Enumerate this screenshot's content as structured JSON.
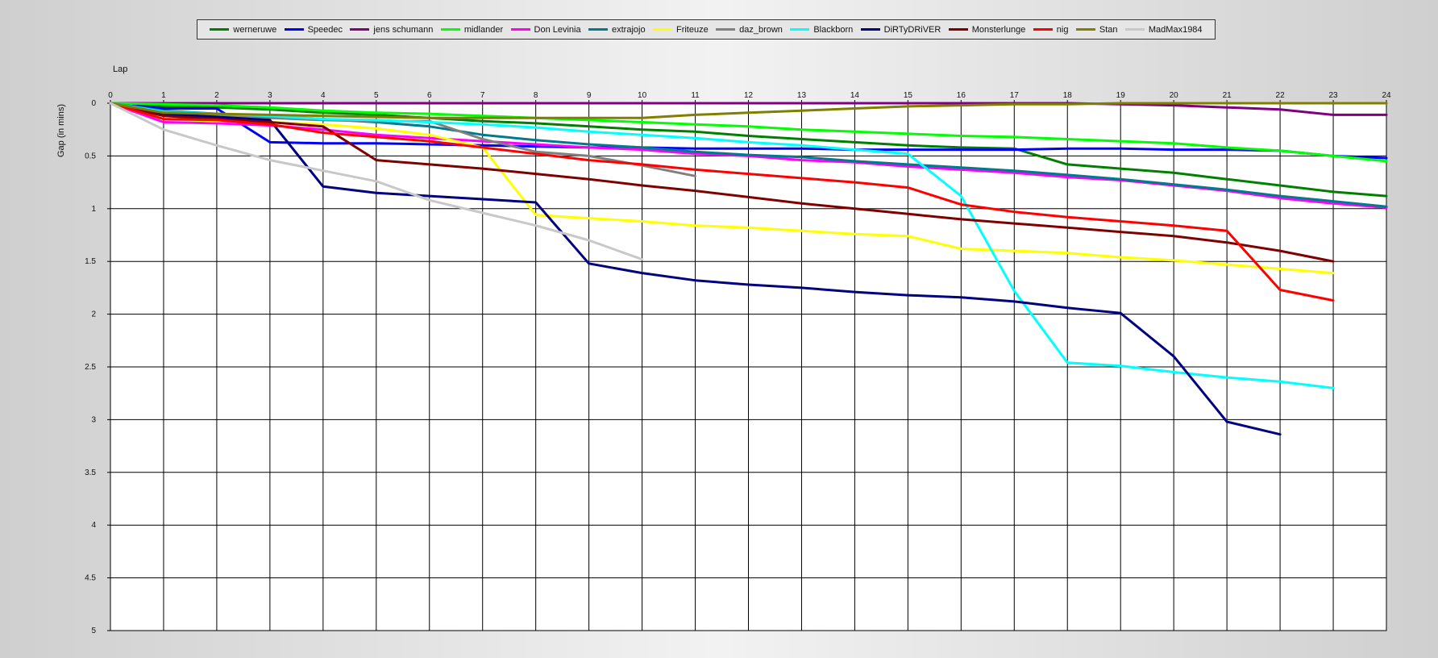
{
  "chart_data": {
    "type": "line",
    "title": "",
    "xlabel": "Lap",
    "ylabel": "Gap (in mins)",
    "xlim": [
      0,
      24
    ],
    "ylim": [
      0,
      5
    ],
    "y_inverted": true,
    "grid": true,
    "legend_position": "top",
    "x_ticks": [
      "0",
      "1",
      "2",
      "3",
      "4",
      "5",
      "6",
      "7",
      "8",
      "9",
      "10",
      "11",
      "12",
      "13",
      "14",
      "15",
      "16",
      "17",
      "18",
      "19",
      "20",
      "21",
      "22",
      "23",
      "24"
    ],
    "y_ticks": [
      "0",
      "0.5",
      "1",
      "1.5",
      "2",
      "2.5",
      "3",
      "3.5",
      "4",
      "4.5",
      "5"
    ],
    "series": [
      {
        "name": "werneruwe",
        "color": "#008000",
        "x": [
          0,
          1,
          2,
          3,
          4,
          5,
          6,
          7,
          8,
          9,
          10,
          11,
          12,
          13,
          14,
          15,
          16,
          17,
          18,
          19,
          20,
          21,
          22,
          23,
          24
        ],
        "values": [
          0,
          0.03,
          0.04,
          0.06,
          0.09,
          0.11,
          0.14,
          0.17,
          0.19,
          0.22,
          0.25,
          0.27,
          0.31,
          0.34,
          0.37,
          0.4,
          0.42,
          0.43,
          0.58,
          0.62,
          0.66,
          0.72,
          0.78,
          0.84,
          0.88
        ]
      },
      {
        "name": "Speedec",
        "color": "#0000FF",
        "x": [
          0,
          1,
          2,
          3,
          4,
          5,
          6,
          7,
          8,
          9,
          10,
          11,
          12,
          13,
          14,
          15,
          16,
          17,
          18,
          19,
          20,
          21,
          22,
          23,
          24
        ],
        "values": [
          0,
          0.05,
          0.05,
          0.37,
          0.38,
          0.38,
          0.39,
          0.4,
          0.41,
          0.42,
          0.42,
          0.43,
          0.43,
          0.43,
          0.44,
          0.44,
          0.44,
          0.44,
          0.43,
          0.43,
          0.44,
          0.44,
          0.45,
          0.5,
          0.52
        ]
      },
      {
        "name": "jens  schumann",
        "color": "#800080",
        "x": [
          0,
          1,
          2,
          3,
          4,
          5,
          6,
          7,
          8,
          9,
          10,
          11,
          12,
          13,
          14,
          15,
          16,
          17,
          18,
          19,
          20,
          21,
          22,
          23,
          24
        ],
        "values": [
          0,
          0,
          0,
          0,
          0,
          0,
          0,
          0,
          0,
          0,
          0,
          0,
          0,
          0,
          0,
          0,
          0,
          0,
          0,
          0.01,
          0.02,
          0.04,
          0.06,
          0.11,
          0.11
        ]
      },
      {
        "name": "midlander",
        "color": "#00FF00",
        "x": [
          0,
          1,
          2,
          3,
          4,
          5,
          6,
          7,
          8,
          9,
          10,
          11,
          12,
          13,
          14,
          15,
          16,
          17,
          18,
          19,
          20,
          21,
          22,
          23,
          24
        ],
        "values": [
          0,
          0.01,
          0.02,
          0.04,
          0.07,
          0.09,
          0.1,
          0.12,
          0.14,
          0.16,
          0.18,
          0.2,
          0.22,
          0.25,
          0.27,
          0.29,
          0.31,
          0.32,
          0.34,
          0.36,
          0.38,
          0.42,
          0.45,
          0.5,
          0.55
        ]
      },
      {
        "name": "Don Levinia",
        "color": "#FF00FF",
        "x": [
          0,
          1,
          2,
          3,
          4,
          5,
          6,
          7,
          8,
          9,
          10,
          11,
          12,
          13,
          14,
          15,
          16,
          17,
          18,
          19,
          20,
          21,
          22,
          23,
          24
        ],
        "values": [
          0,
          0.18,
          0.19,
          0.21,
          0.25,
          0.3,
          0.33,
          0.36,
          0.39,
          0.42,
          0.44,
          0.48,
          0.5,
          0.54,
          0.56,
          0.6,
          0.63,
          0.66,
          0.7,
          0.73,
          0.78,
          0.83,
          0.9,
          0.95,
          0.99
        ]
      },
      {
        "name": "extrajojo",
        "color": "#007A8C",
        "x": [
          0,
          1,
          2,
          3,
          4,
          5,
          6,
          7,
          8,
          9,
          10,
          11,
          12,
          13,
          14,
          15,
          16,
          17,
          18,
          19,
          20,
          21,
          22,
          23,
          24
        ],
        "values": [
          0,
          0.07,
          0.1,
          0.12,
          0.15,
          0.18,
          0.22,
          0.3,
          0.35,
          0.39,
          0.42,
          0.46,
          0.49,
          0.51,
          0.55,
          0.58,
          0.61,
          0.64,
          0.68,
          0.72,
          0.77,
          0.82,
          0.88,
          0.93,
          0.98
        ]
      },
      {
        "name": "Friteuze",
        "color": "#FFFF00",
        "x": [
          0,
          1,
          2,
          3,
          4,
          5,
          6,
          7,
          8,
          9,
          10,
          11,
          12,
          13,
          14,
          15,
          16,
          17,
          18,
          19,
          20,
          21,
          22,
          23
        ],
        "values": [
          0,
          0.15,
          0.17,
          0.18,
          0.2,
          0.24,
          0.3,
          0.42,
          1.06,
          1.09,
          1.12,
          1.16,
          1.18,
          1.21,
          1.24,
          1.26,
          1.38,
          1.4,
          1.42,
          1.46,
          1.49,
          1.53,
          1.57,
          1.61
        ]
      },
      {
        "name": "daz_brown",
        "color": "#808080",
        "x": [
          0,
          1,
          2,
          3,
          4,
          5,
          6,
          7,
          8,
          9,
          10,
          11
        ],
        "values": [
          0,
          0.12,
          0.12,
          0.14,
          0.16,
          0.17,
          0.17,
          0.34,
          0.46,
          0.5,
          0.59,
          0.69
        ]
      },
      {
        "name": "Blackborn",
        "color": "#00FFFF",
        "x": [
          0,
          1,
          2,
          3,
          4,
          5,
          6,
          7,
          8,
          9,
          10,
          11,
          12,
          13,
          14,
          15,
          16,
          17,
          18,
          19,
          20,
          21,
          22,
          23
        ],
        "values": [
          0,
          0.08,
          0.1,
          0.12,
          0.15,
          0.16,
          0.18,
          0.2,
          0.23,
          0.27,
          0.3,
          0.33,
          0.37,
          0.4,
          0.44,
          0.48,
          0.88,
          1.78,
          2.46,
          2.49,
          2.55,
          2.6,
          2.64,
          2.7
        ]
      },
      {
        "name": "DiRTyDRiVER",
        "color": "#000080",
        "x": [
          0,
          1,
          2,
          3,
          4,
          5,
          6,
          7,
          8,
          9,
          10,
          11,
          12,
          13,
          14,
          15,
          16,
          17,
          18,
          19,
          20,
          21,
          22
        ],
        "values": [
          0,
          0.1,
          0.13,
          0.16,
          0.79,
          0.85,
          0.88,
          0.91,
          0.94,
          1.52,
          1.61,
          1.68,
          1.72,
          1.75,
          1.79,
          1.82,
          1.84,
          1.88,
          1.94,
          1.99,
          2.4,
          3.02,
          3.14
        ]
      },
      {
        "name": "Monsterlunge",
        "color": "#800000",
        "x": [
          0,
          1,
          2,
          3,
          4,
          5,
          6,
          7,
          8,
          9,
          10,
          11,
          12,
          13,
          14,
          15,
          16,
          17,
          18,
          19,
          20,
          21,
          22,
          23
        ],
        "values": [
          0,
          0.12,
          0.15,
          0.18,
          0.22,
          0.54,
          0.58,
          0.62,
          0.67,
          0.72,
          0.78,
          0.83,
          0.89,
          0.95,
          1.0,
          1.05,
          1.1,
          1.14,
          1.18,
          1.22,
          1.26,
          1.32,
          1.4,
          1.5
        ]
      },
      {
        "name": "nig",
        "color": "#FF0000",
        "x": [
          0,
          1,
          2,
          3,
          4,
          5,
          6,
          7,
          8,
          9,
          10,
          11,
          12,
          13,
          14,
          15,
          16,
          17,
          18,
          19,
          20,
          21,
          22,
          23
        ],
        "values": [
          0,
          0.15,
          0.16,
          0.2,
          0.28,
          0.32,
          0.36,
          0.42,
          0.48,
          0.54,
          0.58,
          0.63,
          0.67,
          0.71,
          0.75,
          0.8,
          0.96,
          1.03,
          1.08,
          1.12,
          1.16,
          1.21,
          1.77,
          1.87
        ]
      },
      {
        "name": "Stan",
        "color": "#808000",
        "x": [
          0,
          1,
          2,
          3,
          4,
          5,
          6,
          7,
          8,
          9,
          10,
          11,
          12,
          13,
          14,
          15,
          16,
          17,
          18,
          19,
          20,
          21,
          22,
          23,
          24
        ],
        "values": [
          0,
          0.09,
          0.1,
          0.11,
          0.12,
          0.13,
          0.14,
          0.14,
          0.14,
          0.14,
          0.14,
          0.11,
          0.09,
          0.07,
          0.05,
          0.03,
          0.02,
          0.01,
          0.01,
          0,
          0,
          0,
          0,
          0,
          0
        ]
      },
      {
        "name": "MadMax1984",
        "color": "#C8C8C8",
        "x": [
          0,
          1,
          2,
          3,
          4,
          5,
          6,
          7,
          8,
          9,
          10
        ],
        "values": [
          0,
          0.25,
          0.4,
          0.54,
          0.64,
          0.74,
          0.92,
          1.04,
          1.16,
          1.3,
          1.48
        ]
      }
    ]
  }
}
